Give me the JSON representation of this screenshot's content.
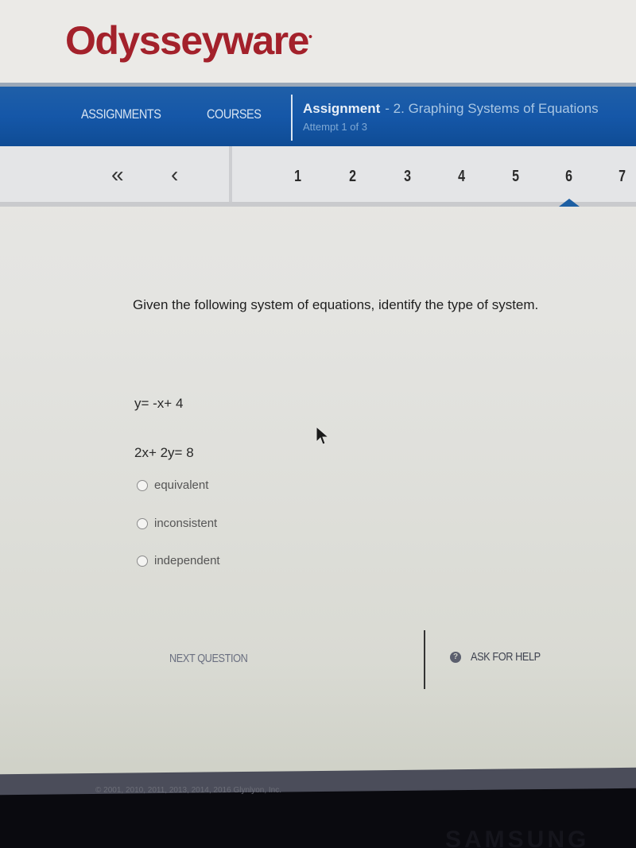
{
  "brand": {
    "logo_text": "Odysseyware",
    "logo_mark": "•",
    "logo_color": "#a3212b"
  },
  "nav": {
    "links": [
      {
        "label": "ASSIGNMENTS"
      },
      {
        "label": "COURSES"
      }
    ],
    "assignment_label": "Assignment",
    "assignment_name": "- 2. Graphing Systems of Equations",
    "attempt_text": "Attempt 1 of 3",
    "bar_color": "#1557a8"
  },
  "question_nav": {
    "first_icon": "double-chevron-left-icon",
    "first_glyph": "«",
    "prev_icon": "chevron-left-icon",
    "prev_glyph": "‹",
    "numbers": [
      "1",
      "2",
      "3",
      "4",
      "5",
      "6",
      "7"
    ],
    "current": "6"
  },
  "question": {
    "prompt": "Given the following system of equations, identify the type of system.",
    "equations": [
      "y= -x+ 4",
      "2x+ 2y= 8"
    ],
    "options": [
      {
        "label": "equivalent",
        "selected": false
      },
      {
        "label": "inconsistent",
        "selected": false
      },
      {
        "label": "independent",
        "selected": false
      }
    ]
  },
  "actions": {
    "next_label": "NEXT QUESTION",
    "help_label": "ASK FOR HELP",
    "help_icon_glyph": "?"
  },
  "footer": {
    "copyright": "© 2001, 2010, 2011, 2013, 2014, 2016 Glynlyon, Inc."
  },
  "bezel": {
    "brand": "SAMSUNG"
  }
}
